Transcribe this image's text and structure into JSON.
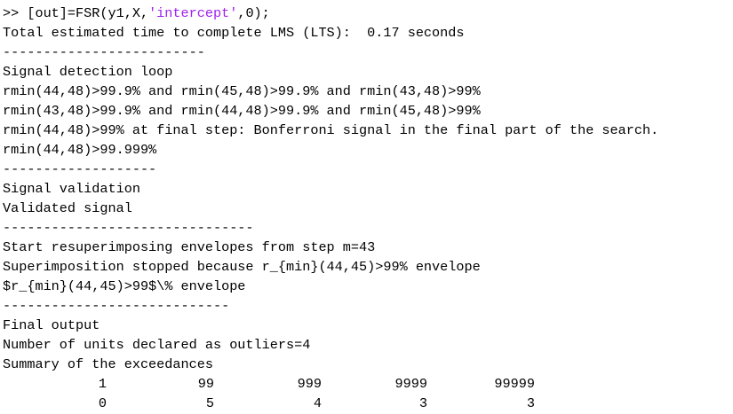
{
  "console": {
    "command": {
      "prompt": ">> ",
      "code_before": "[out]=FSR(y1,X,",
      "string_arg": "'intercept'",
      "code_after": ",0);"
    },
    "lines": [
      "Total estimated time to complete LMS (LTS):  0.17 seconds",
      "-------------------------",
      "Signal detection loop",
      "rmin(44,48)>99.9% and rmin(45,48)>99.9% and rmin(43,48)>99%",
      "rmin(43,48)>99.9% and rmin(44,48)>99.9% and rmin(45,48)>99%",
      "rmin(44,48)>99% at final step: Bonferroni signal in the final part of the search.",
      "rmin(44,48)>99.999%",
      "-------------------",
      "Signal validation",
      "Validated signal",
      "-------------------------------",
      "Start resuperimposing envelopes from step m=43",
      "Superimposition stopped because r_{min}(44,45)>99% envelope",
      "$r_{min}(44,45)>99$\\% envelope",
      "----------------------------",
      "Final output",
      "Number of units declared as outliers=4",
      "Summary of the exceedances"
    ],
    "table": {
      "header": [
        "1",
        "99",
        "999",
        "9999",
        "99999"
      ],
      "values": [
        "0",
        "5",
        "4",
        "3",
        "3"
      ]
    }
  }
}
